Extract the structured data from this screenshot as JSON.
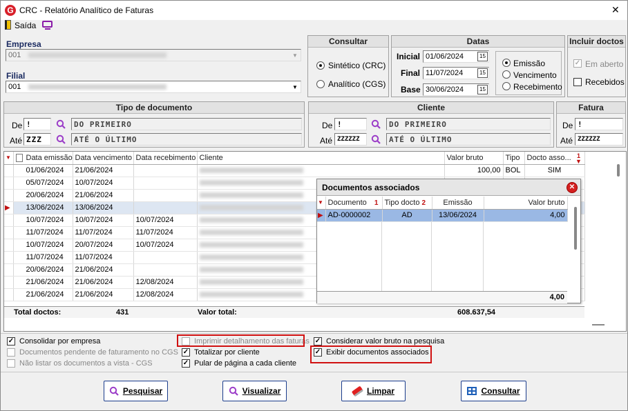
{
  "window": {
    "title": "CRC - Relatório Analítico de Faturas",
    "close": "✕"
  },
  "menu": {
    "exit": "Saída"
  },
  "empresa": {
    "label": "Empresa",
    "code": "001"
  },
  "filial": {
    "label": "Filial",
    "code": "001"
  },
  "consultar": {
    "title": "Consultar",
    "opt1": "Sintético (CRC)",
    "opt2": "Analítico (CGS)"
  },
  "datas": {
    "title": "Datas",
    "inicial_label": "Inicial",
    "inicial": "01/06/2024",
    "final_label": "Final",
    "final": "11/07/2024",
    "base_label": "Base",
    "base": "30/06/2024",
    "r1": "Emissão",
    "r2": "Vencimento",
    "r3": "Recebimento"
  },
  "incluir": {
    "title": "Incluir doctos",
    "c1": "Em aberto",
    "c2": "Recebidos"
  },
  "tipo": {
    "title": "Tipo de documento",
    "de": "De",
    "ate": "Até",
    "de_val": "!",
    "ate_val": "ZZZ",
    "first": "DO PRIMEIRO",
    "last": "ATÉ O ÚLTIMO"
  },
  "cliente": {
    "title": "Cliente",
    "de": "De",
    "ate": "Até",
    "de_val": "!",
    "ate_val": "ZZZZZZ",
    "first": "DO PRIMEIRO",
    "last": "ATÉ O ÚLTIMO"
  },
  "fatura": {
    "title": "Fatura",
    "de": "De",
    "ate": "Até",
    "de_val": "!",
    "ate_val": "ZZZZZZ"
  },
  "grid": {
    "headers": [
      "Data emissão",
      "Data vencimento",
      "Data recebimento",
      "Cliente",
      "Valor bruto",
      "Tipo",
      "Docto asso..."
    ],
    "rows": [
      [
        "01/06/2024",
        "21/06/2024",
        "",
        "",
        "100,00",
        "BOL",
        "SIM"
      ],
      [
        "05/07/2024",
        "10/07/2024",
        "",
        "",
        "",
        "",
        ""
      ],
      [
        "20/06/2024",
        "21/06/2024",
        "",
        "",
        "",
        "",
        ""
      ],
      [
        "13/06/2024",
        "13/06/2024",
        "",
        "",
        "",
        "",
        ""
      ],
      [
        "10/07/2024",
        "10/07/2024",
        "10/07/2024",
        "",
        "",
        "",
        ""
      ],
      [
        "11/07/2024",
        "11/07/2024",
        "11/07/2024",
        "",
        "",
        "",
        ""
      ],
      [
        "10/07/2024",
        "20/07/2024",
        "10/07/2024",
        "",
        "",
        "",
        ""
      ],
      [
        "11/07/2024",
        "11/07/2024",
        "",
        "",
        "",
        "",
        ""
      ],
      [
        "20/06/2024",
        "21/06/2024",
        "",
        "",
        "",
        "",
        ""
      ],
      [
        "21/06/2024",
        "21/06/2024",
        "12/08/2024",
        "",
        "",
        "",
        ""
      ],
      [
        "21/06/2024",
        "21/06/2024",
        "12/08/2024",
        "",
        "",
        "",
        ""
      ]
    ],
    "total_docs_label": "Total doctos:",
    "total_docs": "431",
    "valor_total_label": "Valor total:",
    "valor_total": "608.637,54"
  },
  "popup": {
    "title": "Documentos associados",
    "headers": [
      "Documento",
      "Tipo docto",
      "Emissão",
      "Valor bruto"
    ],
    "sort1": "1",
    "sort2": "2",
    "row": [
      "AD-0000002",
      "AD",
      "13/06/2024",
      "4,00"
    ],
    "total": "4,00"
  },
  "options": {
    "o1": "Consolidar por empresa",
    "o2": "Documentos pendente de faturamento no CGS",
    "o3": "Não listar os documentos a vista - CGS",
    "o4": "Imprimir detalhamento das faturas",
    "o5": "Totalizar por cliente",
    "o6": "Pular de página a cada cliente",
    "o7": "Considerar valor bruto na pesquisa",
    "o8": "Exibir documentos associados"
  },
  "buttons": {
    "pesquisar": "Pesquisar",
    "visualizar": "Visualizar",
    "limpar": "Limpar",
    "consultar": "Consultar"
  },
  "colors": {
    "accent": "#1a3c8c",
    "highlight": "#d01010",
    "selected_row": "#9ab8e4"
  }
}
